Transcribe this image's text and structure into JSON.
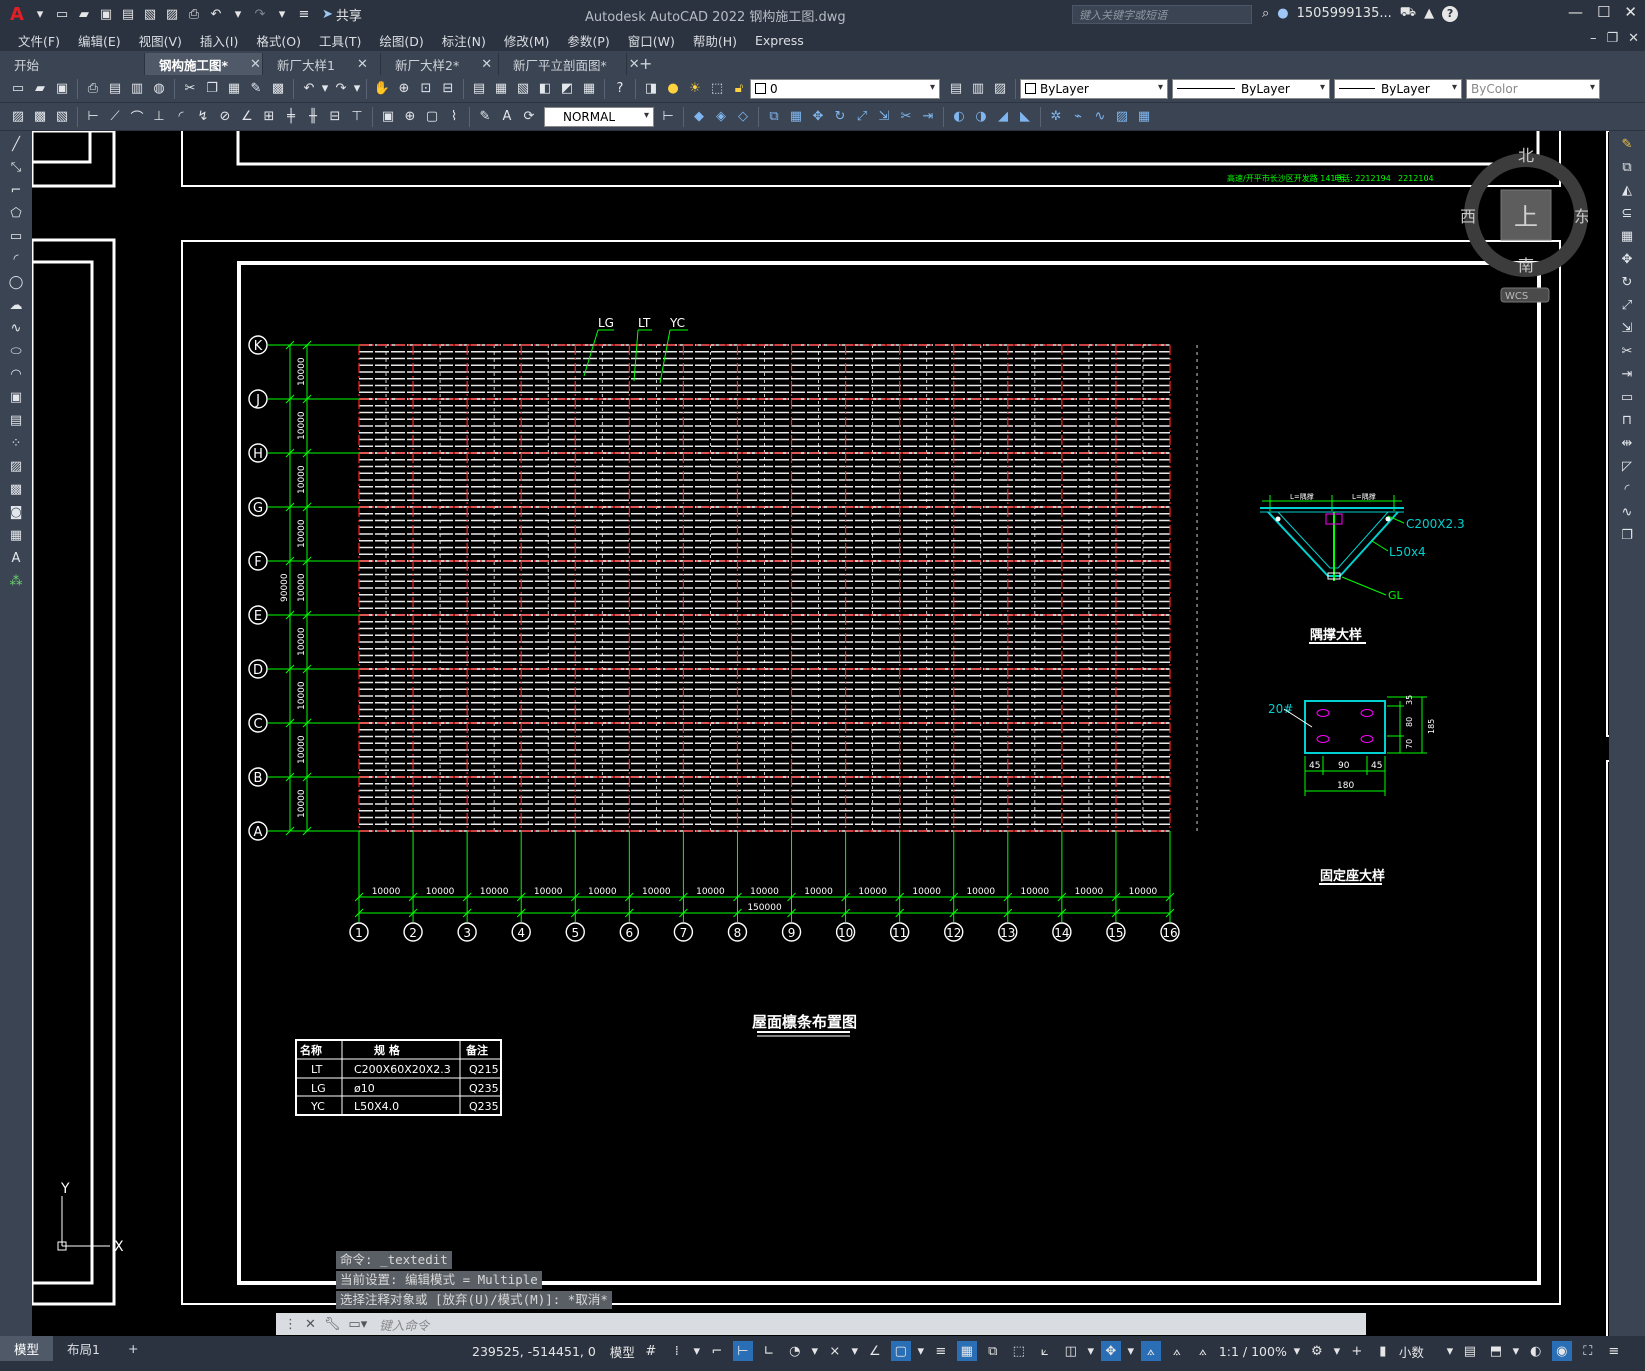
{
  "app": {
    "logo": "A",
    "share_label": "共享",
    "title": "Autodesk AutoCAD 2022    钢构施工图.dwg",
    "search_placeholder": "键入关键字或短语",
    "username": "1505999135...",
    "help": "?"
  },
  "menu": [
    "文件(F)",
    "编辑(E)",
    "视图(V)",
    "插入(I)",
    "格式(O)",
    "工具(T)",
    "绘图(D)",
    "标注(N)",
    "修改(M)",
    "参数(P)",
    "窗口(W)",
    "帮助(H)",
    "Express"
  ],
  "tabs": [
    {
      "label": "开始",
      "closable": false,
      "active": false
    },
    {
      "label": "钢构施工图*",
      "closable": true,
      "active": true
    },
    {
      "label": "新厂大样1",
      "closable": true,
      "active": false
    },
    {
      "label": "新厂大样2*",
      "closable": true,
      "active": false
    },
    {
      "label": "新厂平立剖面图*",
      "closable": true,
      "active": false
    }
  ],
  "toolbar": {
    "layer_value": "0",
    "color_value": "ByLayer",
    "linetype_value": "ByLayer",
    "lineweight_value": "ByLayer",
    "plotstyle_value": "ByColor",
    "textstyle_value": "NORMAL"
  },
  "viewcube": {
    "north": "北",
    "south": "南",
    "east": "东",
    "west": "西",
    "top": "上",
    "wcs": "WCS"
  },
  "drawing": {
    "header_note_left": "高速/开平市长沙区开发路 141 号",
    "header_note_tel1": "电话: 2212194",
    "header_note_tel2": "2212104",
    "row_axes": [
      "K",
      "J",
      "H",
      "G",
      "F",
      "E",
      "D",
      "C",
      "B",
      "A"
    ],
    "col_axes": [
      "1",
      "2",
      "3",
      "4",
      "5",
      "6",
      "7",
      "8",
      "9",
      "10",
      "11",
      "12",
      "13",
      "14",
      "15",
      "16"
    ],
    "row_dim": "10000",
    "row_total": "90000",
    "col_dim": "10000",
    "col_total": "150000",
    "leader_labels": [
      "LG",
      "LT",
      "YC"
    ],
    "plan_title": "屋面檩条布置图",
    "brace_detail": {
      "title": "隅撑大样",
      "top_dims": [
        "L=隅撑",
        "L=隅撑"
      ],
      "labels": [
        "C200X2.3",
        "L50x4",
        "GL"
      ]
    },
    "base_detail": {
      "title": "固定座大样",
      "label": "20#",
      "dims_bottom": [
        "45",
        "90",
        "45"
      ],
      "dim_total": "180",
      "dims_right": [
        "35",
        "80",
        "70",
        "185"
      ]
    },
    "table": {
      "headers": [
        "名称",
        "规  格",
        "备注"
      ],
      "rows": [
        [
          "LT",
          "C200X60X20X2.3",
          "Q215"
        ],
        [
          "LG",
          "ø10",
          "Q235"
        ],
        [
          "YC",
          "L50X4.0",
          "Q235"
        ]
      ]
    },
    "ucs": {
      "x": "X",
      "y": "Y"
    }
  },
  "command": {
    "history": [
      "命令: _textedit",
      "当前设置: 编辑模式 = Multiple",
      "选择注释对象或 [放弃(U)/模式(M)]: *取消*"
    ],
    "placeholder": "键入命令"
  },
  "status": {
    "layout_tabs": [
      "模型",
      "布局1"
    ],
    "add_layout": "+",
    "coords": "239525, -514451, 0",
    "model_label": "模型",
    "scale": "1:1 / 100%",
    "units": "小数"
  }
}
